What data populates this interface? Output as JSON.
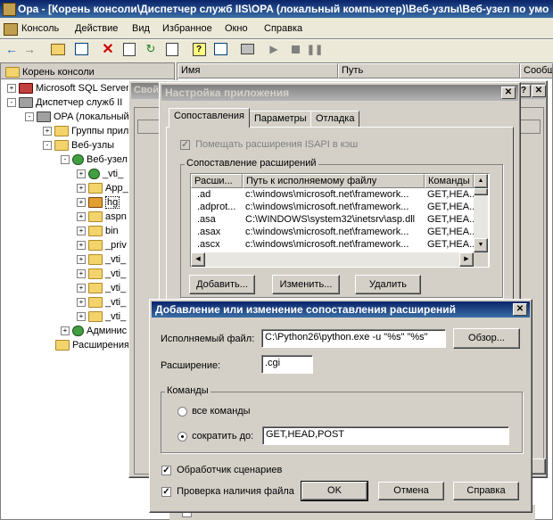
{
  "main_window": {
    "title": "Opa - [Корень консоли\\Диспетчер служб IIS\\OPA (локальный компьютер)\\Веб-узлы\\Веб-узел по умо",
    "menu": [
      "Консоль",
      "Действие",
      "Вид",
      "Избранное",
      "Окно",
      "Справка"
    ],
    "columns": [
      "Имя",
      "Путь",
      "Сообщ"
    ]
  },
  "tree": {
    "items": [
      {
        "label": "Корень консоли"
      },
      {
        "label": "Microsoft SQL Server"
      },
      {
        "label": "Диспетчер служб II"
      },
      {
        "label": "OPA (локальный"
      },
      {
        "label": "Группы прил"
      },
      {
        "label": "Веб-узлы"
      },
      {
        "label": "Веб-узел"
      },
      {
        "label": "_vti_"
      },
      {
        "label": "App_"
      },
      {
        "label": "hg"
      },
      {
        "label": "aspn"
      },
      {
        "label": "bin"
      },
      {
        "label": "_priv"
      },
      {
        "label": "_vti_"
      },
      {
        "label": "_vti_"
      },
      {
        "label": "_vti_"
      },
      {
        "label": "_vti_"
      },
      {
        "label": "_vti_"
      },
      {
        "label": "Админис"
      },
      {
        "label": "Расширения"
      }
    ]
  },
  "props_dialog": {
    "title": "Свой"
  },
  "app_config": {
    "title": "Настройка приложения",
    "tabs": [
      "Сопоставления",
      "Параметры",
      "Отладка"
    ],
    "cache_checkbox": "Помещать расширения ISAPI в кэш",
    "group_title": "Сопоставление расширений",
    "headers": [
      "Расши...",
      "Путь к исполняемому файлу",
      "Команды"
    ],
    "rows": [
      {
        "ext": ".ad",
        "path": "c:\\windows\\microsoft.net\\framework...",
        "cmd": "GET,HEA..."
      },
      {
        "ext": ".adprot...",
        "path": "c:\\windows\\microsoft.net\\framework...",
        "cmd": "GET,HEA..."
      },
      {
        "ext": ".asa",
        "path": "C:\\WINDOWS\\system32\\inetsrv\\asp.dll",
        "cmd": "GET,HEA..."
      },
      {
        "ext": ".asax",
        "path": "c:\\windows\\microsoft.net\\framework...",
        "cmd": "GET,HEA..."
      },
      {
        "ext": ".ascx",
        "path": "c:\\windows\\microsoft.net\\framework...",
        "cmd": "GET,HEA..."
      }
    ],
    "buttons": {
      "add": "Добавить...",
      "edit": "Изменить...",
      "remove": "Удалить"
    }
  },
  "edit_dialog": {
    "title": "Добавление или изменение сопоставления расширений",
    "exe_label": "Исполняемый файл:",
    "exe_value": "C:\\Python26\\python.exe -u \"%s\" \"%s\"",
    "browse": "Обзор...",
    "ext_label": "Расширение:",
    "ext_value": ".cgi",
    "verbs_group": "Команды",
    "all_verbs": "все команды",
    "limit_to": "сократить до:",
    "limit_value": "GET,HEAD,POST",
    "script_engine": "Обработчик сценариев",
    "verify_file": "Проверка наличия файла",
    "ok": "OK",
    "cancel": "Отмена",
    "help": "Справка"
  },
  "colors": {
    "title_active": "#0a246a",
    "face": "#d4d0c8"
  }
}
